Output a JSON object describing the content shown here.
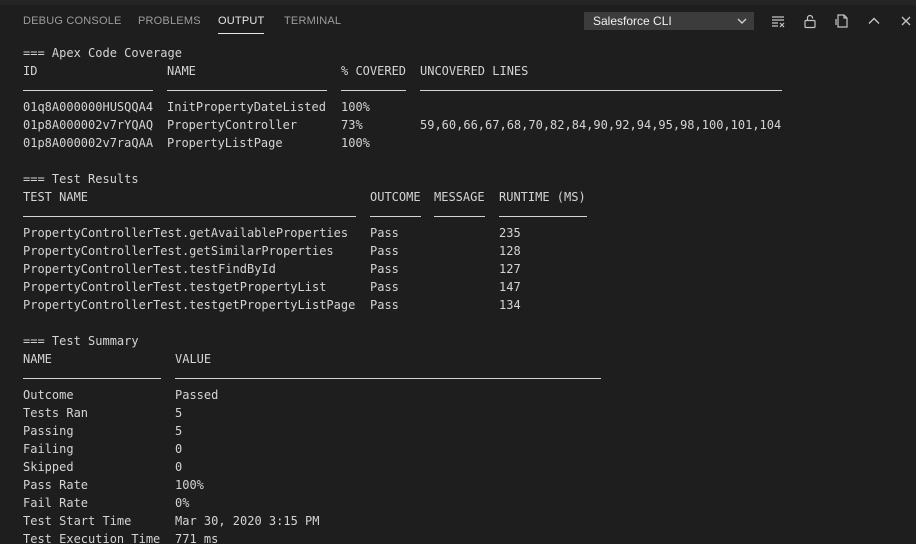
{
  "tabs": [
    {
      "label": "DEBUG CONSOLE"
    },
    {
      "label": "PROBLEMS"
    },
    {
      "label": "OUTPUT"
    },
    {
      "label": "TERMINAL"
    }
  ],
  "channel_select": {
    "value": "Salesforce CLI"
  },
  "actions": [
    "clear-output",
    "lock-scroll",
    "open-in-editor",
    "maximize-panel",
    "close-panel"
  ],
  "coverage": {
    "heading": "=== Apex Code Coverage",
    "headers": [
      "ID",
      "NAME",
      "% COVERED",
      "UNCOVERED LINES"
    ],
    "rows": [
      [
        "01q8A000000HUSQQA4",
        "InitPropertyDateListed",
        "100%",
        ""
      ],
      [
        "01p8A000002v7rYQAQ",
        "PropertyController",
        "73%",
        "59,60,66,67,68,70,82,84,90,92,94,95,98,100,101,104"
      ],
      [
        "01p8A000002v7raQAA",
        "PropertyListPage",
        "100%",
        ""
      ]
    ]
  },
  "results": {
    "heading": "=== Test Results",
    "headers": [
      "TEST NAME",
      "OUTCOME",
      "MESSAGE",
      "RUNTIME (MS)"
    ],
    "rows": [
      [
        "PropertyControllerTest.getAvailableProperties",
        "Pass",
        "",
        "235"
      ],
      [
        "PropertyControllerTest.getSimilarProperties",
        "Pass",
        "",
        "128"
      ],
      [
        "PropertyControllerTest.testFindById",
        "Pass",
        "",
        "127"
      ],
      [
        "PropertyControllerTest.testgetPropertyList",
        "Pass",
        "",
        "147"
      ],
      [
        "PropertyControllerTest.testgetPropertyListPage",
        "Pass",
        "",
        "134"
      ]
    ]
  },
  "summary": {
    "heading": "=== Test Summary",
    "headers": [
      "NAME",
      "VALUE"
    ],
    "rows": [
      [
        "Outcome",
        "Passed"
      ],
      [
        "Tests Ran",
        "5"
      ],
      [
        "Passing",
        "5"
      ],
      [
        "Failing",
        "0"
      ],
      [
        "Skipped",
        "0"
      ],
      [
        "Pass Rate",
        "100%"
      ],
      [
        "Fail Rate",
        "0%"
      ],
      [
        "Test Start Time",
        "Mar 30, 2020 3:15 PM"
      ],
      [
        "Test Execution Time",
        "771 ms"
      ]
    ]
  }
}
